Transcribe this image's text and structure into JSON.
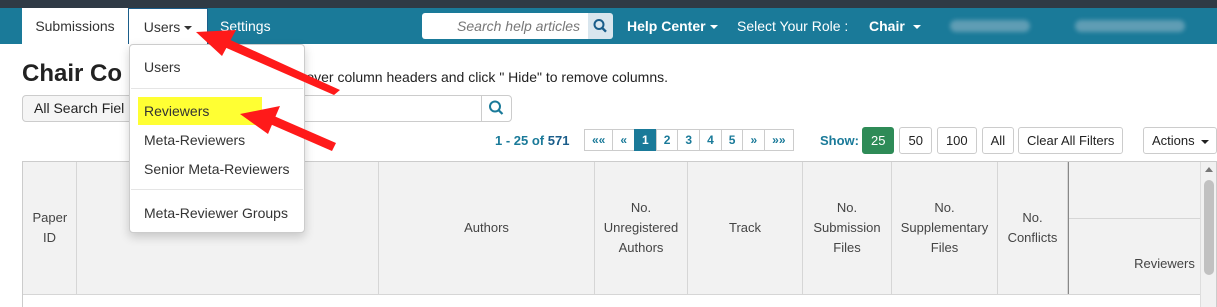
{
  "nav": {
    "tabs": [
      {
        "label": "Submissions"
      },
      {
        "label": "Users"
      },
      {
        "label": "Settings"
      }
    ],
    "search_placeholder": "Search help articles",
    "help_center": "Help Center",
    "role_label": "Select Your Role :",
    "role_value": "Chair"
  },
  "page": {
    "title": "Chair Co",
    "help_text": "er over column headers and click \" Hide\" to remove columns."
  },
  "filters": {
    "search_fields": "All Search Fiel"
  },
  "pagination": {
    "range_prefix": "1 - 25 of",
    "total": "571",
    "buttons": [
      "««",
      "«",
      "1",
      "2",
      "3",
      "4",
      "5",
      "»",
      "»»"
    ],
    "active_page": "1"
  },
  "show": {
    "label": "Show:",
    "options": [
      "25",
      "50",
      "100",
      "All"
    ],
    "selected": "25"
  },
  "toolbar": {
    "clear_filters": "Clear All Filters",
    "actions": "Actions"
  },
  "table": {
    "columns": [
      "Paper ID",
      "",
      "Authors",
      "No. Unregistered Authors",
      "Track",
      "No. Submission Files",
      "No. Supplementary Files",
      "No. Conflicts",
      "Reviewers"
    ]
  },
  "users_menu": {
    "items": [
      "Users",
      "Reviewers",
      "Meta-Reviewers",
      "Senior Meta-Reviewers",
      "Meta-Reviewer Groups"
    ],
    "highlighted": "Reviewers"
  },
  "colors": {
    "nav_bg": "#1a7a99",
    "top_strip": "#2f3a45",
    "highlight": "#ffff33",
    "arrow": "#ff1a1a",
    "show_active": "#2e8b57"
  }
}
